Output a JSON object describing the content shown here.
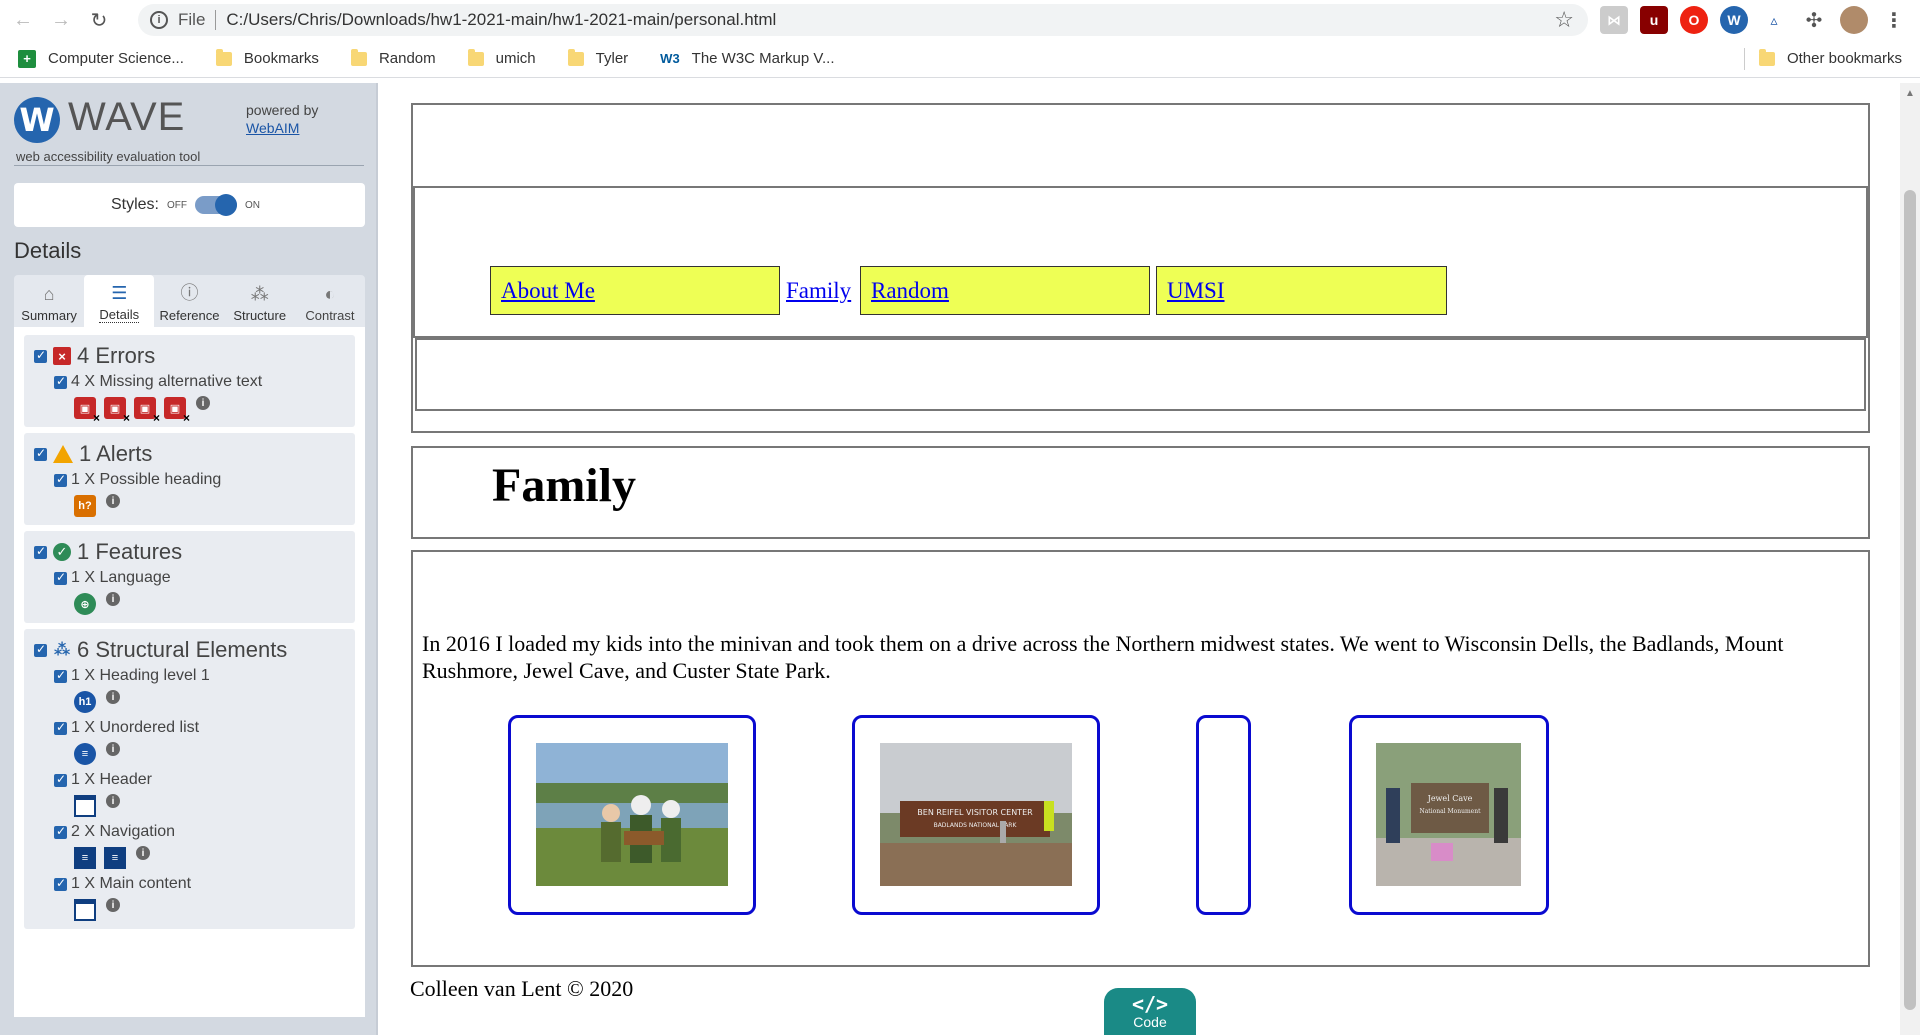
{
  "browser": {
    "url_scheme": "File",
    "url": "C:/Users/Chris/Downloads/hw1-2021-main/hw1-2021-main/personal.html",
    "bookmarks": [
      {
        "label": "Computer Science...",
        "icon": "google-sheets-icon"
      },
      {
        "label": "Bookmarks",
        "icon": "folder-icon"
      },
      {
        "label": "Random",
        "icon": "folder-icon"
      },
      {
        "label": "umich",
        "icon": "folder-icon"
      },
      {
        "label": "Tyler",
        "icon": "folder-icon"
      },
      {
        "label": "The W3C Markup V...",
        "icon": "w3c-icon"
      }
    ],
    "other_bookmarks": "Other bookmarks"
  },
  "wave": {
    "logo_text": "WAVE",
    "tagline": "web accessibility evaluation tool",
    "powered_by": "powered by",
    "webaim": "WebAIM",
    "styles_label": "Styles:",
    "styles_off": "OFF",
    "styles_on": "ON",
    "details_heading": "Details",
    "tabs": [
      {
        "label": "Summary",
        "icon": "home-icon"
      },
      {
        "label": "Details",
        "icon": "list-icon"
      },
      {
        "label": "Reference",
        "icon": "info-icon"
      },
      {
        "label": "Structure",
        "icon": "structure-icon"
      },
      {
        "label": "Contrast",
        "icon": "contrast-icon"
      }
    ],
    "groups": {
      "errors": {
        "title": "4 Errors",
        "items": [
          "4 X Missing alternative text"
        ]
      },
      "alerts": {
        "title": "1 Alerts",
        "items": [
          "1 X Possible heading"
        ]
      },
      "features": {
        "title": "1 Features",
        "items": [
          "1 X Language"
        ]
      },
      "structure": {
        "title": "6 Structural Elements",
        "items": [
          "1 X Heading level 1",
          "1 X Unordered list",
          "1 X Header",
          "2 X Navigation",
          "1 X Main content"
        ]
      }
    },
    "icon_labels": {
      "h1": "h1",
      "possible_heading": "h?"
    }
  },
  "page": {
    "nav": [
      "About Me",
      "Family",
      "Random",
      "UMSI"
    ],
    "title": "Family",
    "intro": "In 2016 I loaded my kids into the minivan and took them on a drive across the Northern midwest states. We went to Wisconsin Dells, the Badlands, Mount Rushmore, Jewel Cave, and Custer State Park.",
    "photos": [
      {
        "alt_icon": "photo-kids-lake"
      },
      {
        "alt_icon": "photo-visitor-center-sign",
        "sign_text": "BEN REIFEL VISITOR CENTER",
        "sign_sub": "BADLANDS NATIONAL PARK"
      },
      {
        "alt_icon": "photo-missing"
      },
      {
        "alt_icon": "photo-jewel-cave-sign",
        "sign_text": "Jewel Cave",
        "sign_sub": "National Monument"
      }
    ],
    "footer": "Colleen van Lent © 2020"
  },
  "code_button": "Code",
  "code_glyph": "</>"
}
